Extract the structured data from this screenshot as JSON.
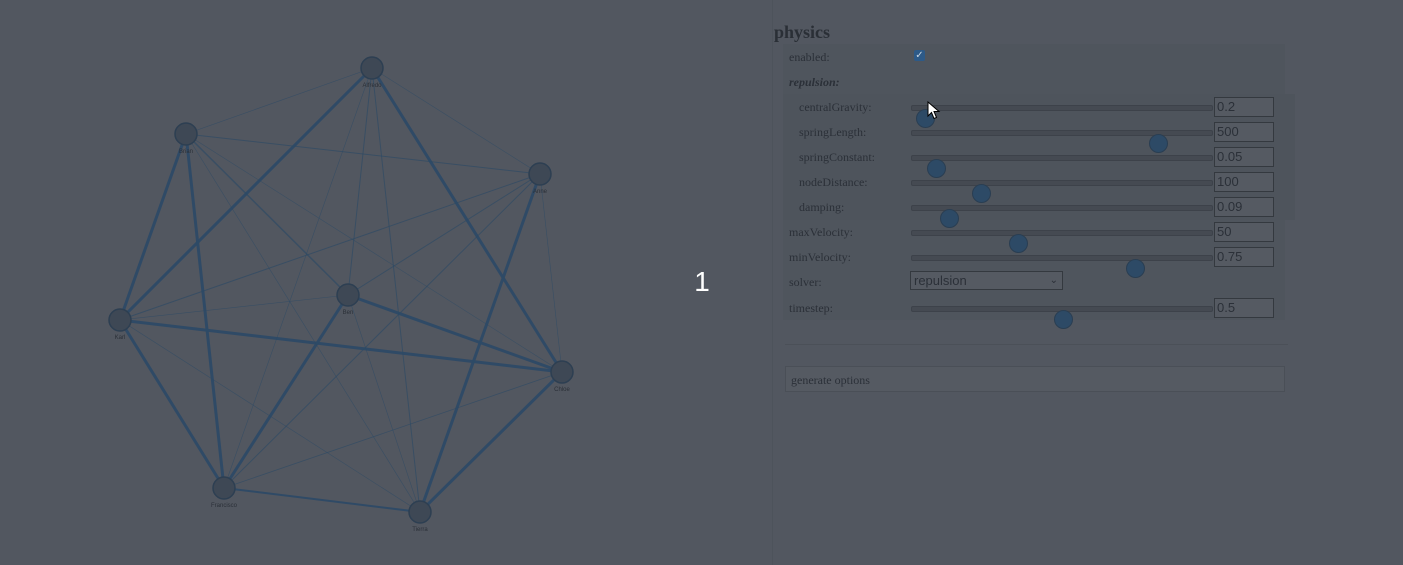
{
  "overlay_number": "1",
  "graph": {
    "nodes": [
      {
        "id": "a",
        "label": "Alfredo"
      },
      {
        "id": "b",
        "label": "Brian"
      },
      {
        "id": "c",
        "label": "Anne"
      },
      {
        "id": "d",
        "label": "Karl"
      },
      {
        "id": "e",
        "label": "Ben"
      },
      {
        "id": "f",
        "label": "Chloe"
      },
      {
        "id": "g",
        "label": "Francisco"
      },
      {
        "id": "h",
        "label": "Tierra"
      }
    ],
    "edge_color": "#2d4a66",
    "node_color": "#3e4855"
  },
  "config": {
    "title": "physics",
    "enabled_label": "enabled:",
    "enabled_checked": true,
    "repulsion_label": "repulsion:",
    "sliders": [
      {
        "label": "centralGravity:",
        "value": "0.2",
        "fraction": 0.04,
        "sub": true
      },
      {
        "label": "springLength:",
        "value": "500",
        "fraction": 0.815,
        "sub": true
      },
      {
        "label": "springConstant:",
        "value": "0.05",
        "fraction": 0.075,
        "sub": true
      },
      {
        "label": "nodeDistance:",
        "value": "100",
        "fraction": 0.225,
        "sub": true
      },
      {
        "label": "damping:",
        "value": "0.09",
        "fraction": 0.12,
        "sub": true
      },
      {
        "label": "maxVelocity:",
        "value": "50",
        "fraction": 0.35,
        "sub": false
      },
      {
        "label": "minVelocity:",
        "value": "0.75",
        "fraction": 0.74,
        "sub": false
      }
    ],
    "solver_label": "solver:",
    "solver_value": "repulsion",
    "timestep_label": "timestep:",
    "timestep_value": "0.5",
    "timestep_fraction": 0.5,
    "generate_label": "generate options"
  }
}
